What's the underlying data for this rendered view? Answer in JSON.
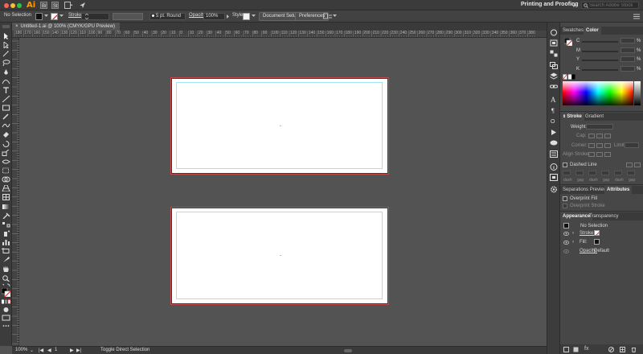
{
  "app": {
    "logo": "Ai",
    "workspace": "Printing and Proofing",
    "search_placeholder": "Search Adobe Stock"
  },
  "control_bar": {
    "selection": "No Selection",
    "stroke_label": "Stroke",
    "brush": "5 pt. Round",
    "opacity_label": "Opacity",
    "opacity_value": "100%",
    "style_label": "Style",
    "document_setup": "Document Setup",
    "preferences": "Preferences"
  },
  "document": {
    "tab_title": "Untitled-1.ai @ 100% (CMYK/GPU Preview)"
  },
  "ruler": {
    "labels": [
      "180",
      "170",
      "160",
      "150",
      "140",
      "130",
      "120",
      "110",
      "100",
      "90",
      "80",
      "70",
      "60",
      "50",
      "40",
      "30",
      "20",
      "10",
      "0",
      "10",
      "20",
      "30",
      "40",
      "50",
      "60",
      "70",
      "80",
      "90",
      "100",
      "110",
      "120",
      "130",
      "140",
      "150",
      "160",
      "170",
      "180",
      "190",
      "200",
      "210",
      "220",
      "230",
      "240",
      "250",
      "260",
      "270",
      "280",
      "290",
      "300",
      "310",
      "320",
      "330",
      "340",
      "350",
      "360",
      "370",
      "380"
    ]
  },
  "status_bar": {
    "zoom": "100%",
    "page": "1",
    "tool_hint": "Toggle Direct Selection"
  },
  "color_panel": {
    "tabs": [
      "Swatches",
      "Color"
    ],
    "channels": [
      {
        "label": "C",
        "unit": "%"
      },
      {
        "label": "M",
        "unit": "%"
      },
      {
        "label": "Y",
        "unit": "%"
      },
      {
        "label": "K",
        "unit": "%"
      }
    ]
  },
  "stroke_panel": {
    "tabs": [
      "Stroke",
      "Gradient"
    ],
    "weight_label": "Weight:",
    "cap_label": "Cap:",
    "corner_label": "Corner:",
    "limit_label": "Limit:",
    "align_label": "Align Stroke:",
    "dashed_label": "Dashed Line",
    "dash_cells": [
      "dash",
      "gap",
      "dash",
      "gap",
      "dash",
      "gap"
    ]
  },
  "attributes_panel": {
    "tabs": [
      "Separations Preview",
      "Attributes"
    ],
    "overprint_fill": "Overprint Fill",
    "overprint_stroke": "Overprint Stroke"
  },
  "appearance_panel": {
    "tabs": [
      "Appearance",
      "Transparency"
    ],
    "header": "No Selection",
    "stroke_label": "Stroke:",
    "fill_label": "Fill:",
    "opacity_label": "Opacity:",
    "opacity_value": "Default"
  },
  "colors": {
    "artboard_bleed": "#c74848",
    "guide": "#9fe3ef",
    "accent": "#ff9a00"
  }
}
